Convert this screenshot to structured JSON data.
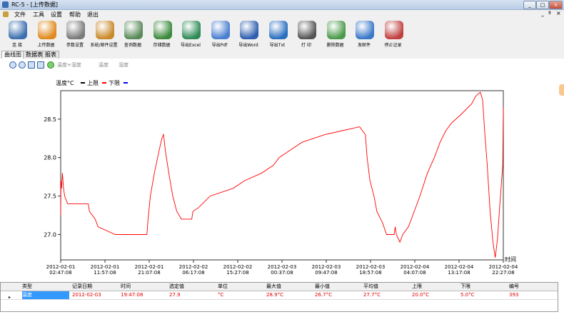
{
  "window": {
    "title": "RC-5 - [上传数据]",
    "controls": [
      "_",
      "□",
      "×"
    ]
  },
  "menu": [
    "文件",
    "工具",
    "设置",
    "帮助",
    "退出"
  ],
  "mdi_controls": [
    "_",
    "ª",
    "×"
  ],
  "toolbar": [
    {
      "label": "连 接",
      "icon": "connect-icon",
      "color": "#3b6fb0"
    },
    {
      "label": "上传数据",
      "icon": "upload-icon",
      "color": "#e08a1e"
    },
    {
      "label": "参数设置",
      "icon": "gear-icon",
      "color": "#7a7a7a"
    },
    {
      "label": "系统/邮件设置",
      "icon": "settings-icon",
      "color": "#c98a2a"
    },
    {
      "label": "查询数据",
      "icon": "query-icon",
      "color": "#5a8a5a"
    },
    {
      "label": "存储数据",
      "icon": "save-icon",
      "color": "#3c8a3c"
    },
    {
      "label": "导出Excel",
      "icon": "excel-icon",
      "color": "#2e8b57"
    },
    {
      "label": "导出Pdf",
      "icon": "pdf-icon",
      "color": "#4a7fd0"
    },
    {
      "label": "导出Word",
      "icon": "word-icon",
      "color": "#2f5fb0"
    },
    {
      "label": "导出Txt",
      "icon": "txt-icon",
      "color": "#2a6fc0"
    },
    {
      "label": "打 印",
      "icon": "print-icon",
      "color": "#555555"
    },
    {
      "label": "删除数据",
      "icon": "trash-icon",
      "color": "#4a9a4a"
    },
    {
      "label": "发邮件",
      "icon": "mail-icon",
      "color": "#3a78c8"
    },
    {
      "label": "停止记录",
      "icon": "stop-icon",
      "color": "#c04040"
    }
  ],
  "tabs": [
    "曲线图",
    "数据表",
    "报表"
  ],
  "chart_tools": {
    "links": [
      "温度+湿度",
      "温度",
      "湿度"
    ]
  },
  "legend": [
    {
      "label": "温度°C",
      "color": "#000000"
    },
    {
      "label": "上限",
      "color": "#ff0000"
    },
    {
      "label": "下限",
      "color": "#0000ff"
    }
  ],
  "chart_data": {
    "type": "line",
    "xlabel": "时间",
    "x_ticks": [
      {
        "date": "2012-02-01",
        "time": "02:47:08"
      },
      {
        "date": "2012-02-01",
        "time": "11:57:08"
      },
      {
        "date": "2012-02-01",
        "time": "21:07:08"
      },
      {
        "date": "2012-02-02",
        "time": "06:17:08"
      },
      {
        "date": "2012-02-02",
        "time": "15:27:08"
      },
      {
        "date": "2012-02-03",
        "time": "00:37:08"
      },
      {
        "date": "2012-02-03",
        "time": "09:47:08"
      },
      {
        "date": "2012-02-03",
        "time": "18:57:08"
      },
      {
        "date": "2012-02-04",
        "time": "04:07:08"
      },
      {
        "date": "2012-02-04",
        "time": "13:17:08"
      },
      {
        "date": "2012-02-04",
        "time": "22:27:08"
      }
    ],
    "y_ticks": [
      "28.5",
      "28.0",
      "27.5",
      "27.0"
    ],
    "ylim": [
      26.67,
      28.87
    ],
    "series": [
      {
        "color": "#ff0000",
        "points": [
          [
            0,
            27.25
          ],
          [
            0.05,
            27.7
          ],
          [
            0.15,
            27.6
          ],
          [
            0.3,
            27.8
          ],
          [
            0.5,
            27.6
          ],
          [
            0.7,
            27.5
          ],
          [
            1.2,
            27.4
          ],
          [
            4.8,
            27.4
          ],
          [
            5.0,
            27.3
          ],
          [
            6.0,
            27.2
          ],
          [
            6.5,
            27.1
          ],
          [
            9.5,
            27.0
          ],
          [
            15.0,
            27.0
          ],
          [
            15.2,
            27.2
          ],
          [
            15.6,
            27.5
          ],
          [
            16.3,
            27.8
          ],
          [
            17.0,
            28.05
          ],
          [
            17.6,
            28.25
          ],
          [
            17.9,
            28.3
          ],
          [
            18.2,
            28.1
          ],
          [
            18.8,
            27.8
          ],
          [
            19.5,
            27.5
          ],
          [
            20.2,
            27.3
          ],
          [
            21.0,
            27.2
          ],
          [
            22.8,
            27.2
          ],
          [
            23.0,
            27.3
          ],
          [
            24.0,
            27.35
          ],
          [
            26.0,
            27.5
          ],
          [
            30.0,
            27.6
          ],
          [
            32.0,
            27.7
          ],
          [
            35.0,
            27.8
          ],
          [
            37.0,
            27.9
          ],
          [
            38.0,
            28.0
          ],
          [
            39.0,
            28.05
          ],
          [
            40.0,
            28.1
          ],
          [
            42.0,
            28.2
          ],
          [
            46.0,
            28.3
          ],
          [
            49.0,
            28.35
          ],
          [
            52.0,
            28.4
          ],
          [
            53.0,
            28.3
          ],
          [
            53.3,
            28.0
          ],
          [
            53.8,
            27.7
          ],
          [
            54.5,
            27.5
          ],
          [
            55.0,
            27.3
          ],
          [
            56.0,
            27.15
          ],
          [
            56.7,
            27.0
          ],
          [
            58.0,
            27.0
          ],
          [
            58.2,
            27.1
          ],
          [
            58.4,
            27.0
          ],
          [
            58.7,
            26.95
          ],
          [
            59.0,
            26.9
          ],
          [
            59.5,
            27.0
          ],
          [
            60.5,
            27.1
          ],
          [
            61.5,
            27.3
          ],
          [
            62.5,
            27.5
          ],
          [
            63.8,
            27.8
          ],
          [
            65.0,
            28.0
          ],
          [
            66.0,
            28.2
          ],
          [
            67.0,
            28.35
          ],
          [
            68.0,
            28.45
          ],
          [
            69.5,
            28.55
          ],
          [
            71.5,
            28.7
          ],
          [
            72.2,
            28.8
          ],
          [
            73.0,
            28.85
          ],
          [
            73.4,
            28.75
          ],
          [
            73.8,
            28.3
          ],
          [
            74.2,
            27.9
          ],
          [
            74.7,
            27.3
          ],
          [
            75.2,
            26.9
          ],
          [
            75.6,
            26.7
          ],
          [
            76.0,
            26.95
          ],
          [
            76.4,
            27.4
          ],
          [
            76.7,
            27.7
          ],
          [
            76.9,
            27.9
          ],
          [
            77.0,
            28.65
          ]
        ]
      }
    ],
    "x_range": [
      0,
      77.0
    ]
  },
  "table": {
    "columns": [
      "类型",
      "记录日期",
      "时间",
      "选定值",
      "单位",
      "最大值",
      "最小值",
      "平均值",
      "上限",
      "下限",
      "编号"
    ],
    "rows": [
      [
        "温度",
        "2012-02-03",
        "19:47:08",
        "27.9",
        "°C",
        "28.9°C",
        "26.7°C",
        "27.7°C",
        "20.0°C",
        "5.0°C",
        "393"
      ]
    ],
    "row_marker": "▸"
  }
}
